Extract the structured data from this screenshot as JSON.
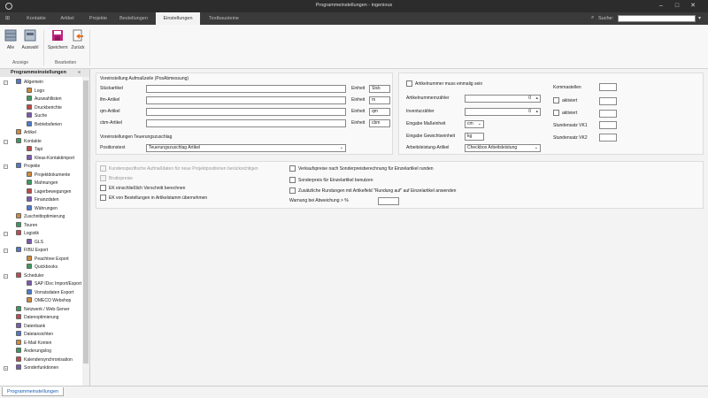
{
  "window": {
    "title": "Programmeinstellungen - ingenious"
  },
  "tabs": [
    "Kontakte",
    "Artikel",
    "Projekte",
    "Bestellungen",
    "Einstellungen",
    "Textbausteine"
  ],
  "search": {
    "label": "Suche:",
    "value": ""
  },
  "ribbon": {
    "buttons": [
      "Alle",
      "Auswahl",
      "Speichern",
      "Zurück"
    ],
    "groups": [
      "Anzeige",
      "Bearbeiten"
    ]
  },
  "sidebar": {
    "header": "Programmeinstellungen",
    "collapse": "«",
    "tree": [
      {
        "label": "Allgemein",
        "level": 0,
        "toggle": "−"
      },
      {
        "label": "Logo",
        "level": 1
      },
      {
        "label": "Auswahllisten",
        "level": 1
      },
      {
        "label": "Druckberichte",
        "level": 1
      },
      {
        "label": "Suche",
        "level": 1
      },
      {
        "label": "Betriebsferien",
        "level": 1
      },
      {
        "label": "Artikel",
        "level": 0
      },
      {
        "label": "Kontakte",
        "level": 0,
        "toggle": "−"
      },
      {
        "label": "Tapi",
        "level": 1
      },
      {
        "label": "Kleas-Kontaktimport",
        "level": 1
      },
      {
        "label": "Projekte",
        "level": 0,
        "toggle": "−"
      },
      {
        "label": "Projektdokumente",
        "level": 1
      },
      {
        "label": "Mahnungen",
        "level": 1
      },
      {
        "label": "Lagerbewegungen",
        "level": 1
      },
      {
        "label": "Finanzdaten",
        "level": 1
      },
      {
        "label": "Währungen",
        "level": 1
      },
      {
        "label": "Zuschnittoptimierung",
        "level": 0
      },
      {
        "label": "Touren",
        "level": 0
      },
      {
        "label": "Logistik",
        "level": 0,
        "toggle": "−"
      },
      {
        "label": "GLS",
        "level": 1
      },
      {
        "label": "FIBU Export",
        "level": 0,
        "toggle": "−"
      },
      {
        "label": "Peachtree Export",
        "level": 1
      },
      {
        "label": "Quickbooks",
        "level": 1
      },
      {
        "label": "Scheduler",
        "level": 0,
        "toggle": "−"
      },
      {
        "label": "SAP IDoc Import/Export",
        "level": 1
      },
      {
        "label": "Vorratsdaten Export",
        "level": 1
      },
      {
        "label": "OMECO Webshop",
        "level": 1
      },
      {
        "label": "Netzwerk / Web-Server",
        "level": 0
      },
      {
        "label": "Datenoptimierung",
        "level": 0
      },
      {
        "label": "Datenbank",
        "level": 0
      },
      {
        "label": "Dateiansichten",
        "level": 0
      },
      {
        "label": "E-Mail Konten",
        "level": 0
      },
      {
        "label": "Änderungslog",
        "level": 0
      },
      {
        "label": "Kalendersynchronisation",
        "level": 0
      },
      {
        "label": "Sonderfunktionen",
        "level": 0,
        "toggle": "+"
      }
    ]
  },
  "form": {
    "markup_section": "Voreinstellung Aufmaßzeile (PosAbmessung)",
    "markup_rows": [
      {
        "label": "Stückartikel",
        "unit_label": "Einheit",
        "unit": "Stck"
      },
      {
        "label": "lfm-Artikel",
        "unit_label": "Einheit",
        "unit": "m"
      },
      {
        "label": "qm-Artikel",
        "unit_label": "Einheit",
        "unit": "qm"
      },
      {
        "label": "cbm-Artikel",
        "unit_label": "Einheit",
        "unit": "cbm"
      }
    ],
    "surcharge_section": "Voreinstellungen Teuerungszuschlag",
    "position_text_label": "Positionstext",
    "position_text_value": "Teuerungszuschlag Artikel",
    "unique_label": "Artikelnummer muss einmalig sein",
    "counter_label": "Artikelnummernzähler",
    "counter_value": "0",
    "inventory_label": "Inventurzähler",
    "inventory_value": "0",
    "measure_label": "Eingabe Maßeinheit",
    "measure_value": "cm",
    "weight_label": "Eingabe Gewichtseinheit",
    "weight_value": "kg",
    "work_label": "Arbeitsleistung-Artikel",
    "work_value": "Checkbox Arbeitsleistung",
    "decimals_label": "Kommastellen",
    "active1_label": "aktiviert",
    "active2_label": "aktiviert",
    "rate1_label": "Stundensatz VK1",
    "rate2_label": "Stundensatz VK2",
    "opts_left": [
      {
        "label": "Kundenspezifische Aufmaßdaten für neue Projektpositionen berücksichtigen",
        "disabled": true
      },
      {
        "label": "Bruttopreise",
        "disabled": true
      },
      {
        "label": "EK einschließlich Verschnitt berechnen",
        "disabled": false
      },
      {
        "label": "EK von Bestellungen in Artikelstamm übernehmen",
        "disabled": false
      }
    ],
    "opts_right": [
      {
        "label": "Verkaufspreise nach Sonderpreisberechnung für Einzelartikel runden"
      },
      {
        "label": "Sonderpreis für Einzelartikel benutzen"
      },
      {
        "label": "Zusätzliche Rundungen mit Artikelfeld \"Rundung auf\" auf Einzelartikel anwenden"
      }
    ],
    "warning_label": "Warnung bei Abweichung > %"
  },
  "bottom_tab": "Programmeinstellungen"
}
